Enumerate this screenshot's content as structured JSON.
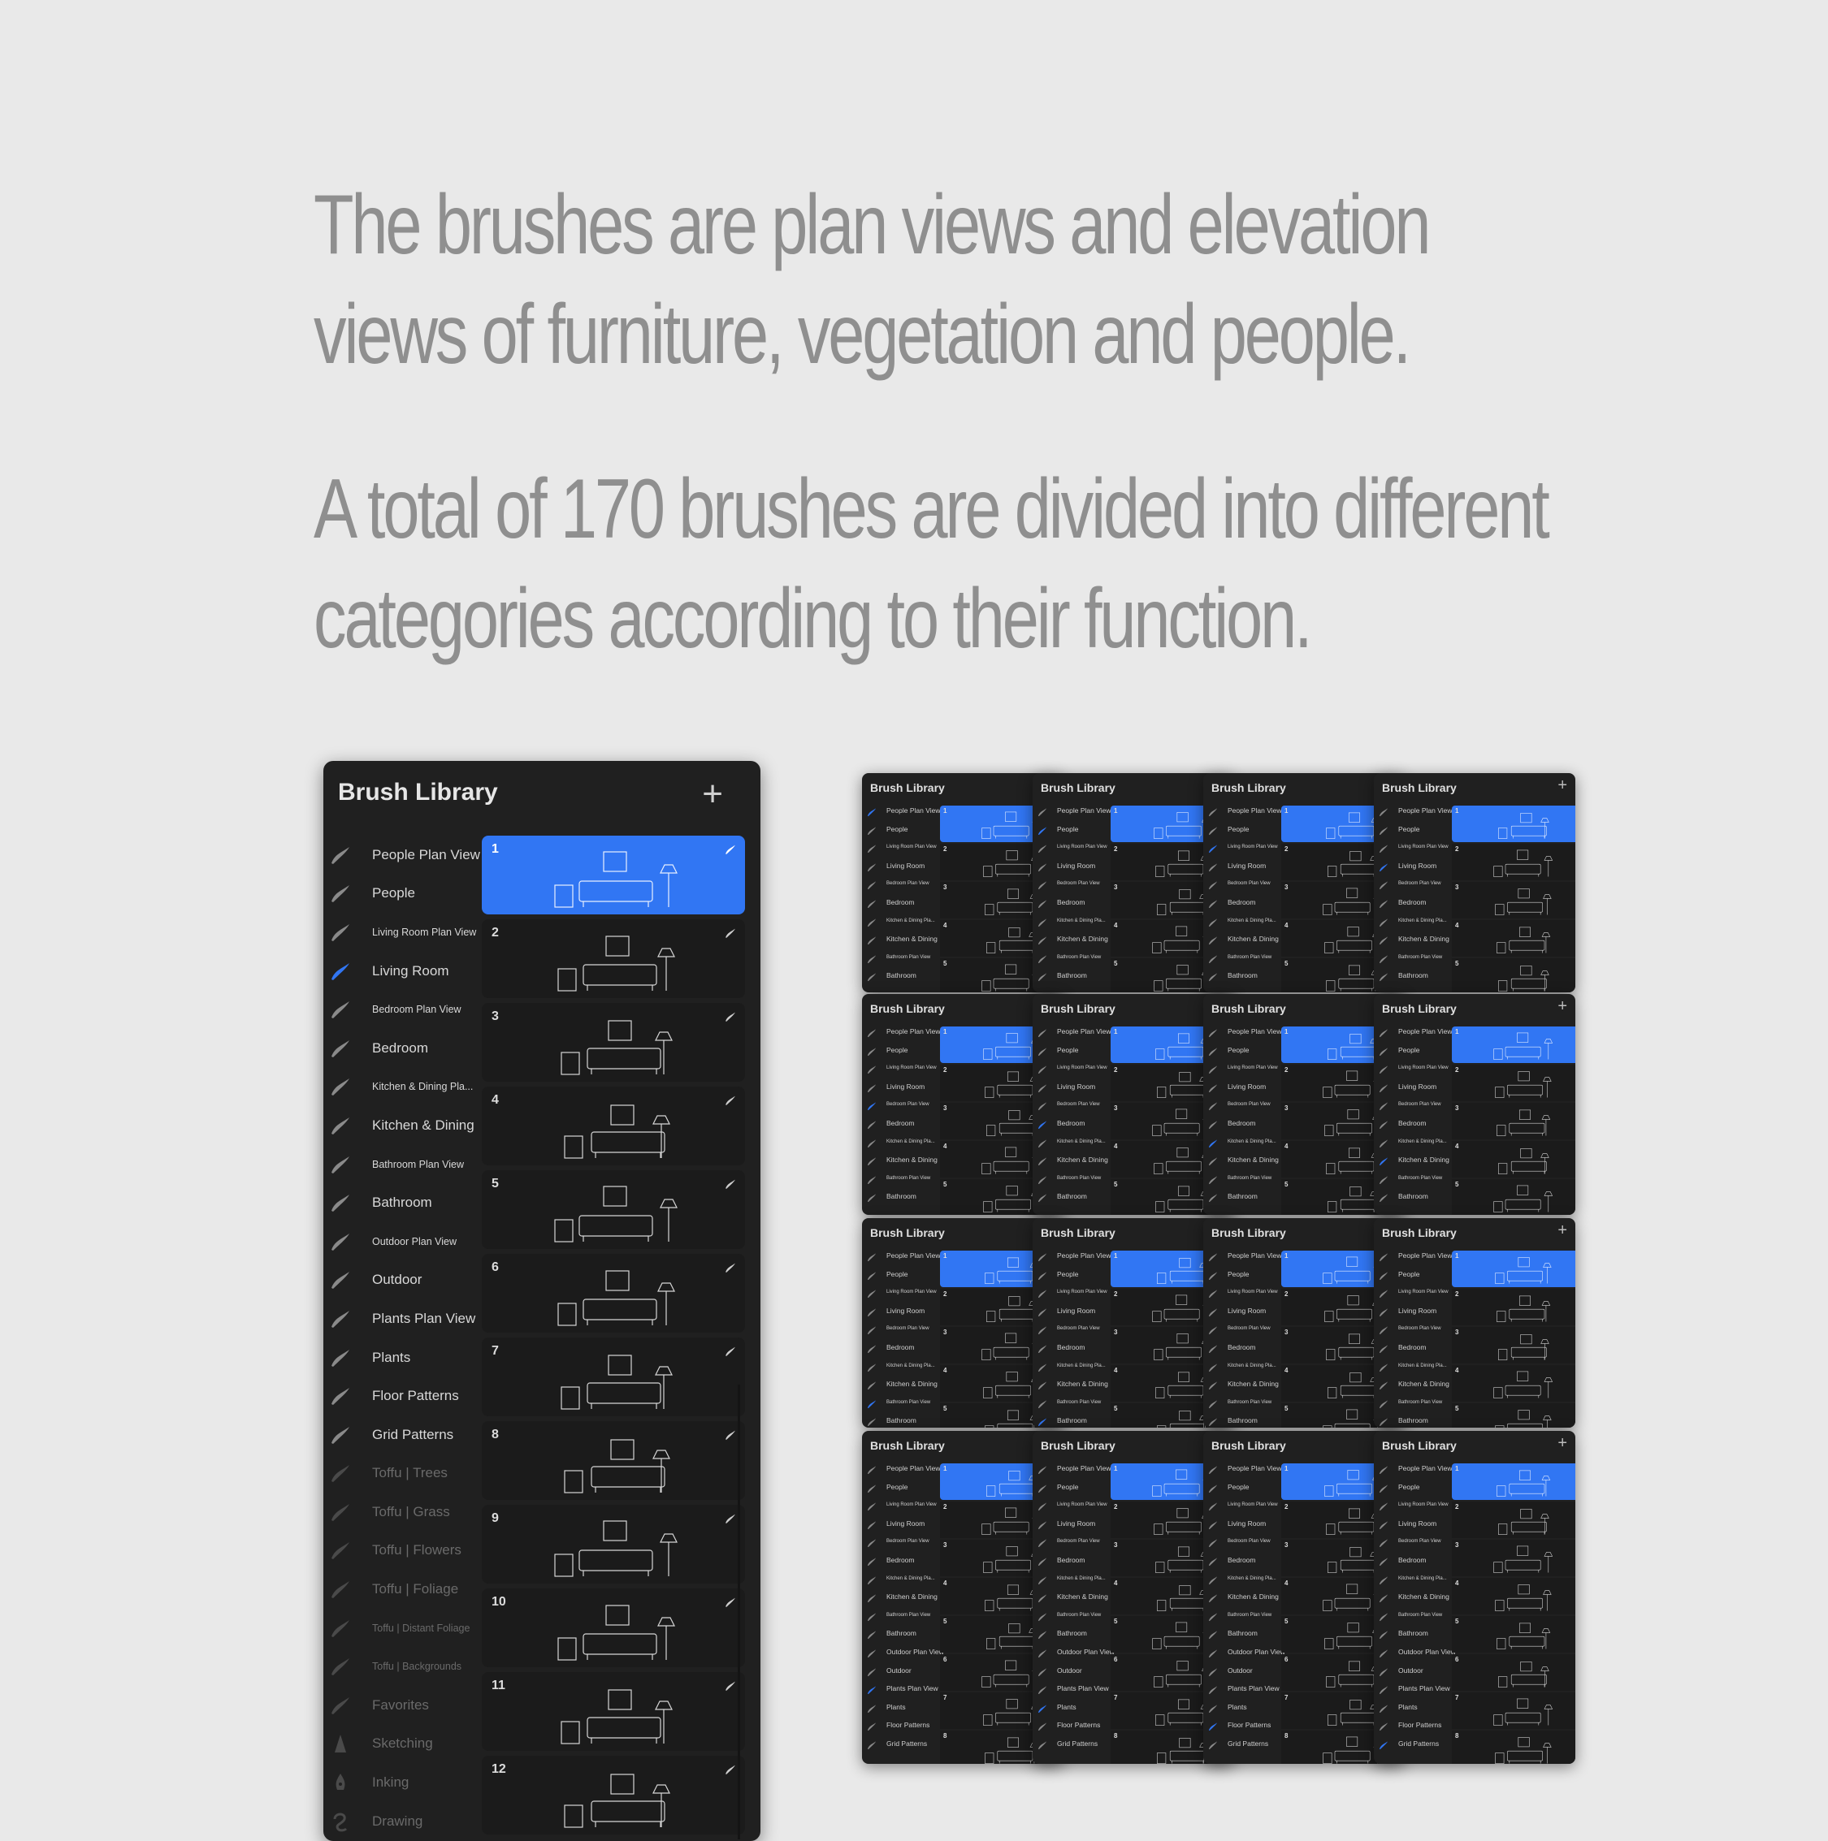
{
  "intro": {
    "paragraph_1": "The brushes are plan views and elevation views of furniture, vegetation and people.",
    "paragraph_2": "A total of 170 brushes are divided into different categories according to their function."
  },
  "colors": {
    "background": "#e9e9e9",
    "text": "#8f8f8f",
    "panel": "#202020",
    "brush_card": "#1b1b1b",
    "accent": "#3176f3"
  },
  "brush_library": {
    "title": "Brush Library",
    "add_button_icon": "plus-icon",
    "brush_sets": [
      {
        "label": "People Plan View",
        "active": false,
        "dim": false,
        "icon": "brush-stroke-icon"
      },
      {
        "label": "People",
        "active": false,
        "dim": false,
        "icon": "brush-stroke-icon"
      },
      {
        "label": "Living Room Plan View",
        "active": false,
        "dim": false,
        "small": true,
        "icon": "brush-stroke-icon"
      },
      {
        "label": "Living Room",
        "active": true,
        "dim": false,
        "icon": "brush-stroke-icon"
      },
      {
        "label": "Bedroom Plan View",
        "active": false,
        "dim": false,
        "small": true,
        "icon": "brush-stroke-icon"
      },
      {
        "label": "Bedroom",
        "active": false,
        "dim": false,
        "icon": "brush-stroke-icon"
      },
      {
        "label": "Kitchen & Dining Pla...",
        "active": false,
        "dim": false,
        "small": true,
        "icon": "brush-stroke-icon"
      },
      {
        "label": "Kitchen & Dining",
        "active": false,
        "dim": false,
        "icon": "brush-stroke-icon"
      },
      {
        "label": "Bathroom Plan View",
        "active": false,
        "dim": false,
        "small": true,
        "icon": "brush-stroke-icon"
      },
      {
        "label": "Bathroom",
        "active": false,
        "dim": false,
        "icon": "brush-stroke-icon"
      },
      {
        "label": "Outdoor Plan View",
        "active": false,
        "dim": false,
        "small": true,
        "icon": "brush-stroke-icon"
      },
      {
        "label": "Outdoor",
        "active": false,
        "dim": false,
        "icon": "brush-stroke-icon"
      },
      {
        "label": "Plants Plan View",
        "active": false,
        "dim": false,
        "icon": "brush-stroke-icon"
      },
      {
        "label": "Plants",
        "active": false,
        "dim": false,
        "icon": "brush-stroke-icon"
      },
      {
        "label": "Floor Patterns",
        "active": false,
        "dim": false,
        "icon": "brush-stroke-icon"
      },
      {
        "label": "Grid Patterns",
        "active": false,
        "dim": false,
        "icon": "brush-stroke-icon"
      },
      {
        "label": "Toffu | Trees",
        "active": false,
        "dim": true,
        "icon": "brush-stroke-icon"
      },
      {
        "label": "Toffu | Grass",
        "active": false,
        "dim": true,
        "icon": "brush-stroke-icon"
      },
      {
        "label": "Toffu | Flowers",
        "active": false,
        "dim": true,
        "icon": "brush-stroke-icon"
      },
      {
        "label": "Toffu | Foliage",
        "active": false,
        "dim": true,
        "icon": "brush-stroke-icon"
      },
      {
        "label": "Toffu | Distant Foliage",
        "active": false,
        "dim": true,
        "small": true,
        "icon": "brush-stroke-icon"
      },
      {
        "label": "Toffu | Backgrounds",
        "active": false,
        "dim": true,
        "small": true,
        "icon": "brush-stroke-icon"
      },
      {
        "label": "Favorites",
        "active": false,
        "dim": true,
        "icon": "brush-stroke-icon"
      },
      {
        "label": "Sketching",
        "active": false,
        "dim": true,
        "icon": "pencil-tip-icon"
      },
      {
        "label": "Inking",
        "active": false,
        "dim": true,
        "icon": "pen-nib-icon"
      },
      {
        "label": "Drawing",
        "active": false,
        "dim": true,
        "icon": "squiggle-icon"
      }
    ],
    "brushes": [
      {
        "number": "1",
        "selected": true,
        "preview": "living-room-sofa-elevation"
      },
      {
        "number": "2",
        "selected": false,
        "preview": "armchair-floor-lamp-elevation"
      },
      {
        "number": "3",
        "selected": false,
        "preview": "plant-chair-sideboard-elevation"
      },
      {
        "number": "4",
        "selected": false,
        "preview": "guitar-sofa-shelves-elevation"
      },
      {
        "number": "5",
        "selected": false,
        "preview": "bookshelf-chair-elevation"
      },
      {
        "number": "6",
        "selected": false,
        "preview": "armchair-desk-plant-elevation"
      },
      {
        "number": "7",
        "selected": false,
        "preview": "chaise-sofa-side-table-elevation"
      },
      {
        "number": "8",
        "selected": false,
        "preview": "plant-console-frame-elevation"
      },
      {
        "number": "9",
        "selected": false,
        "preview": "stool-table-armchair-elevation"
      },
      {
        "number": "10",
        "selected": false,
        "preview": "chesterfield-sofa-elevation"
      },
      {
        "number": "11",
        "selected": false,
        "preview": "sofa-plant-elevation"
      },
      {
        "number": "12",
        "selected": false,
        "preview": "gallery-wall-sofa-elevation"
      }
    ]
  },
  "mini_panels": {
    "title": "Brush Library",
    "set_labels": [
      "People Plan View",
      "People",
      "Living Room Plan View",
      "Living Room",
      "Bedroom Plan View",
      "Bedroom",
      "Kitchen & Dining Pla...",
      "Kitchen & Dining",
      "Bathroom Plan View",
      "Bathroom",
      "Outdoor Plan View",
      "Outdoor",
      "Plants Plan View",
      "Plants",
      "Floor Patterns",
      "Grid Patterns"
    ],
    "rows": [
      {
        "active_sets": [
          "People Plan View",
          "People",
          "Living Room Plan View",
          "Living Room"
        ],
        "visible_sets": 10,
        "brush_count": 5
      },
      {
        "active_sets": [
          "Bedroom Plan View",
          "Bedroom",
          "Kitchen & Dining Pla...",
          "Kitchen & Dining"
        ],
        "visible_sets": 10,
        "brush_count": 5
      },
      {
        "active_sets": [
          "Bathroom Plan View",
          "Bathroom",
          "Outdoor Plan View",
          "Outdoor"
        ],
        "visible_sets": 10,
        "brush_count": 5
      },
      {
        "active_sets": [
          "Plants Plan View",
          "Plants",
          "Floor Patterns",
          "Grid Patterns"
        ],
        "visible_sets": 16,
        "brush_count": 8
      }
    ],
    "brush_numbers": [
      "1",
      "2",
      "3",
      "4",
      "5",
      "6",
      "7",
      "8"
    ]
  }
}
